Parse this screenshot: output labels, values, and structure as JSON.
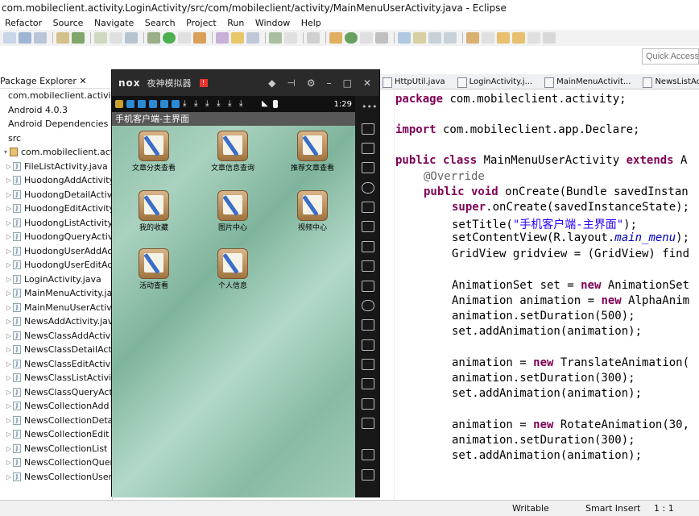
{
  "window": {
    "title": "com.mobileclient.activity.LoginActivity/src/com/mobileclient/activity/MainMenuUserActivity.java - Eclipse"
  },
  "menu": [
    "Refactor",
    "Source",
    "Navigate",
    "Search",
    "Project",
    "Run",
    "Window",
    "Help"
  ],
  "quick_access": {
    "placeholder": "Quick Access"
  },
  "explorer": {
    "title": "Package Explorer",
    "items": [
      {
        "label": "com.mobileclient.activity.LoginA",
        "level": 0,
        "type": "project"
      },
      {
        "label": "Android 4.0.3",
        "level": 0,
        "type": "lib"
      },
      {
        "label": "Android Dependencies",
        "level": 0,
        "type": "lib"
      },
      {
        "label": "src",
        "level": 0,
        "type": "folder"
      },
      {
        "label": "com.mobileclient.activity",
        "level": 1,
        "type": "package"
      },
      {
        "label": "FileListActivity.java",
        "level": 2,
        "type": "java"
      },
      {
        "label": "HuodongAddActivity",
        "level": 2,
        "type": "java"
      },
      {
        "label": "HuodongDetailActivi",
        "level": 2,
        "type": "java"
      },
      {
        "label": "HuodongEditActivity",
        "level": 2,
        "type": "java"
      },
      {
        "label": "HuodongListActivity.",
        "level": 2,
        "type": "java"
      },
      {
        "label": "HuodongQueryActivi",
        "level": 2,
        "type": "java"
      },
      {
        "label": "HuodongUserAddAc",
        "level": 2,
        "type": "java"
      },
      {
        "label": "HuodongUserEditAc",
        "level": 2,
        "type": "java"
      },
      {
        "label": "LoginActivity.java",
        "level": 2,
        "type": "java"
      },
      {
        "label": "MainMenuActivity.jav",
        "level": 2,
        "type": "java"
      },
      {
        "label": "MainMenuUserActivi",
        "level": 2,
        "type": "java"
      },
      {
        "label": "NewsAddActivity.jav",
        "level": 2,
        "type": "java"
      },
      {
        "label": "NewsClassAddActivi",
        "level": 2,
        "type": "java"
      },
      {
        "label": "NewsClassDetailActi",
        "level": 2,
        "type": "java"
      },
      {
        "label": "NewsClassEditActivi",
        "level": 2,
        "type": "java"
      },
      {
        "label": "NewsClassListActivi",
        "level": 2,
        "type": "java"
      },
      {
        "label": "NewsClassQueryActi",
        "level": 2,
        "type": "java"
      },
      {
        "label": "NewsCollectionAdd",
        "level": 2,
        "type": "java"
      },
      {
        "label": "NewsCollectionDeta",
        "level": 2,
        "type": "java"
      },
      {
        "label": "NewsCollectionEdit",
        "level": 2,
        "type": "java"
      },
      {
        "label": "NewsCollectionList",
        "level": 2,
        "type": "java"
      },
      {
        "label": "NewsCollectionQuer",
        "level": 2,
        "type": "java"
      },
      {
        "label": "NewsCollectionUser",
        "level": 2,
        "type": "java"
      }
    ]
  },
  "emulator": {
    "logo": "nox",
    "title": "夜神模拟器",
    "badge": "!",
    "time": "1:29",
    "app_title": "手机客户端-主界面",
    "grid": [
      {
        "label": "文章分类查看"
      },
      {
        "label": "文章信息查询"
      },
      {
        "label": "推荐文章查看"
      },
      {
        "label": "我的收藏"
      },
      {
        "label": "图片中心"
      },
      {
        "label": "视频中心"
      },
      {
        "label": "活动查看"
      },
      {
        "label": "个人信息"
      }
    ]
  },
  "tabs": [
    "HttpUtil.java",
    "LoginActivity.j...",
    "MainMenuActivit...",
    "NewsListAct"
  ],
  "code": {
    "l1_kw": "package",
    "l1": " com.mobileclient.activity;",
    "l2_kw": "import",
    "l2": " com.mobileclient.app.Declare;",
    "l3_kw1": "public",
    "l3_kw2": " class",
    "l3": " MainMenuUserActivity",
    "l3_kw3": " extends",
    "l3_b": " A",
    "l4": "@Override",
    "l5_kw": "public void",
    "l5": " onCreate(Bundle savedInstan",
    "l6_kw": "super",
    "l6": ".onCreate(savedInstanceState);",
    "l7": "setTitle(",
    "l7_str": "\"手机客户端-主界面\"",
    "l7_b": ");",
    "l8": "setContentView(R.layout.",
    "l8_it": "main_menu",
    "l8_b": ");",
    "l9": "GridView gridview = (GridView) find",
    "l10": "AnimationSet set = ",
    "l10_kw": "new",
    "l10_b": " AnimationSet",
    "l11": "Animation animation = ",
    "l11_kw": "new",
    "l11_b": " AlphaAnim",
    "l12": "animation.setDuration(500);",
    "l13": "set.addAnimation(animation);",
    "l14": "animation = ",
    "l14_kw": "new",
    "l14_b": " TranslateAnimation(",
    "l15": "animation.setDuration(300);",
    "l16": "set.addAnimation(animation);",
    "l17": "animation = ",
    "l17_kw": "new",
    "l17_b": " RotateAnimation(30,",
    "l18": "animation.setDuration(300);",
    "l19": "set.addAnimation(animation);"
  },
  "status": {
    "writable": "Writable",
    "insert": "Smart Insert",
    "position": "1 : 1"
  }
}
